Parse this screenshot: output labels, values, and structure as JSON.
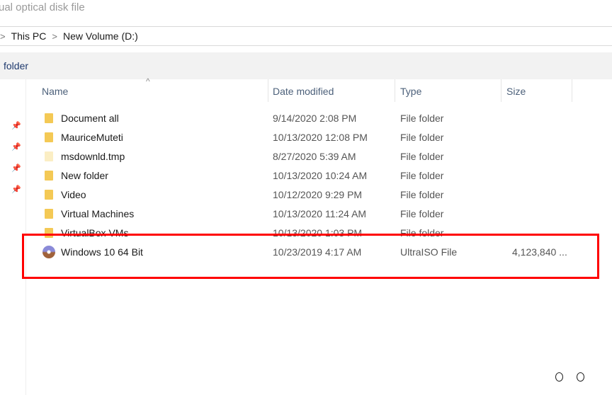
{
  "window": {
    "title": "ual optical disk file"
  },
  "breadcrumb": [
    "This PC",
    "New Volume (D:)"
  ],
  "toolbar": {
    "label": "folder"
  },
  "columns": {
    "name": "Name",
    "date": "Date modified",
    "type": "Type",
    "size": "Size"
  },
  "files": [
    {
      "name": "Document all",
      "date": "9/14/2020 2:08 PM",
      "type": "File folder",
      "size": "",
      "icon": "folder-icon"
    },
    {
      "name": "MauriceMuteti",
      "date": "10/13/2020 12:08 PM",
      "type": "File folder",
      "size": "",
      "icon": "folder-icon"
    },
    {
      "name": "msdownld.tmp",
      "date": "8/27/2020 5:39 AM",
      "type": "File folder",
      "size": "",
      "icon": "folder-icon"
    },
    {
      "name": "New folder",
      "date": "10/13/2020 10:24 AM",
      "type": "File folder",
      "size": "",
      "icon": "folder-icon"
    },
    {
      "name": "Video",
      "date": "10/12/2020 9:29 PM",
      "type": "File folder",
      "size": "",
      "icon": "folder-icon"
    },
    {
      "name": "Virtual Machines",
      "date": "10/13/2020 11:24 AM",
      "type": "File folder",
      "size": "",
      "icon": "folder-icon"
    },
    {
      "name": "VirtualBox VMs",
      "date": "10/13/2020 1:03 PM",
      "type": "File folder",
      "size": "",
      "icon": "folder-icon"
    },
    {
      "name": "Windows 10 64 Bit",
      "date": "10/23/2019 4:17 AM",
      "type": "UltraISO File",
      "size": "4,123,840 ...",
      "icon": "iso-disc-icon"
    }
  ],
  "colors": {
    "highlight": "#ff0000",
    "folder": "#f4c955"
  }
}
